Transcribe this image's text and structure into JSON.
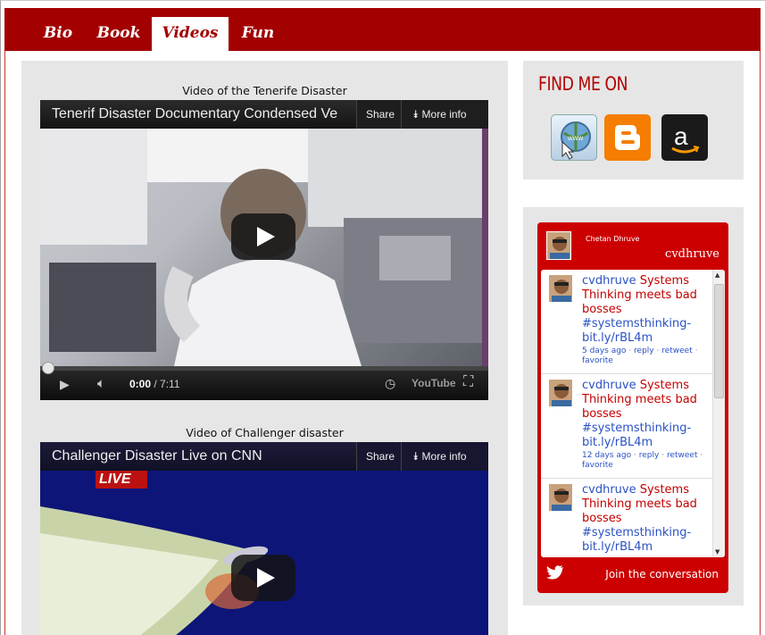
{
  "nav": {
    "tabs": [
      {
        "label": "Bio",
        "active": false
      },
      {
        "label": "Book",
        "active": false
      },
      {
        "label": "Videos",
        "active": true
      },
      {
        "label": "Fun",
        "active": false
      }
    ]
  },
  "videos": [
    {
      "caption": "Video of the Tenerife Disaster",
      "title": "Tenerif Disaster Documentary Condensed Ve",
      "share_label": "Share",
      "more_info_label": "More info",
      "time_current": "0:00",
      "time_total": " / 7:11",
      "progress": 0,
      "brand": "YouTube"
    },
    {
      "caption": "Video of Challenger disaster",
      "title": "Challenger Disaster Live on CNN",
      "share_label": "Share",
      "more_info_label": "More info",
      "overlay_text": "LIVE"
    }
  ],
  "sidebar": {
    "find_title": "FIND ME ON",
    "social": [
      {
        "icon": "globe-www-icon",
        "color": "#d8e8f4"
      },
      {
        "icon": "blogger-icon",
        "color": "#f57d00"
      },
      {
        "icon": "amazon-icon",
        "color": "#1a1a1a"
      }
    ]
  },
  "twitter": {
    "name": "Chetan Dhruve",
    "handle": "cvdhruve",
    "join_label": "Join the conversation",
    "tweets": [
      {
        "user": "cvdhruve",
        "text": " Systems Thinking meets bad bosses ",
        "link": "#systemsthinking-bit.ly/rBL4m",
        "time": "5 days ago",
        "reply": "reply",
        "retweet": "retweet",
        "favorite": "favorite"
      },
      {
        "user": "cvdhruve",
        "text": " Systems Thinking meets bad bosses ",
        "link": "#systemsthinking-bit.ly/rBL4m",
        "time": "12 days ago",
        "reply": "reply",
        "retweet": "retweet",
        "favorite": "favorite"
      },
      {
        "user": "cvdhruve",
        "text": " Systems Thinking meets bad bosses ",
        "link": "#systemsthinking-bit.ly/rBL4m"
      }
    ]
  },
  "colors": {
    "brand_red": "#a30000",
    "twitter_red": "#cc0000",
    "link_blue": "#2b52c5"
  }
}
